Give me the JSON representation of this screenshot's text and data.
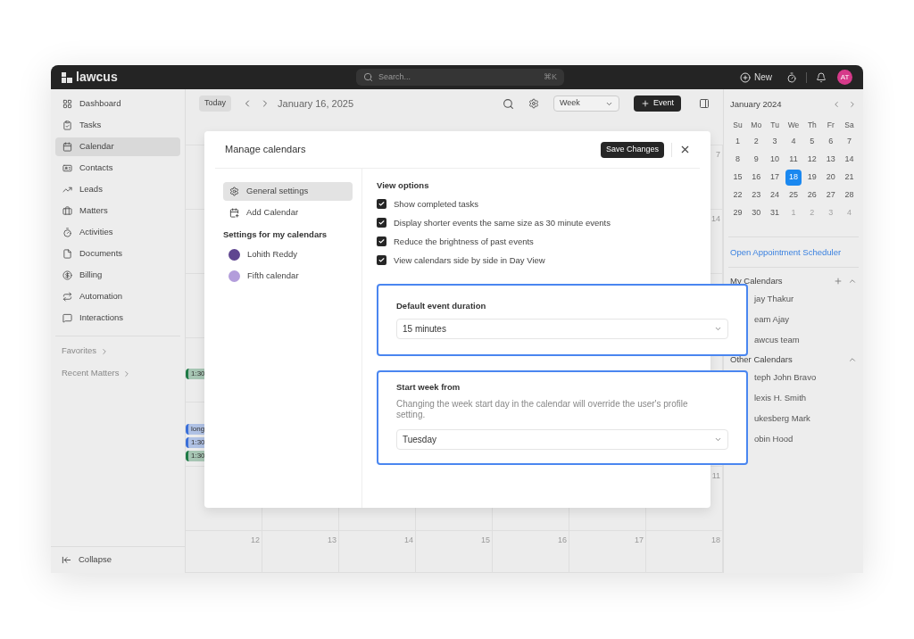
{
  "topbar": {
    "logo": "lawcus",
    "search_placeholder": "Search...",
    "shortcut": "⌘K",
    "new_button": "New",
    "avatar": "AT"
  },
  "sidebar": {
    "items": [
      {
        "kind": "dashboard",
        "label": "Dashboard",
        "selected": false
      },
      {
        "kind": "tasks",
        "label": "Tasks",
        "selected": false
      },
      {
        "kind": "calendar",
        "label": "Calendar",
        "selected": true
      },
      {
        "kind": "contacts",
        "label": "Contacts",
        "selected": false
      },
      {
        "kind": "leads",
        "label": "Leads",
        "selected": false
      },
      {
        "kind": "matters",
        "label": "Matters",
        "selected": false
      },
      {
        "kind": "activities",
        "label": "Activities",
        "selected": false
      },
      {
        "kind": "documents",
        "label": "Documents",
        "selected": false
      },
      {
        "kind": "billing",
        "label": "Billing",
        "selected": false
      },
      {
        "kind": "automation",
        "label": "Automation",
        "selected": false
      },
      {
        "kind": "interactions",
        "label": "Interactions",
        "selected": false
      }
    ],
    "sections": [
      "Favorites",
      "Recent Matters"
    ],
    "collapse": "Collapse"
  },
  "toolbar": {
    "today": "Today",
    "date": "January 16, 2025",
    "view": "Week",
    "event_button": "Event"
  },
  "grid": {
    "rows": [
      {
        "last_day": "7"
      },
      {
        "last_day": "14"
      },
      {},
      {
        "events": [
          {
            "label": "1:30",
            "color": "#1f7a46"
          }
        ]
      },
      {
        "events": [
          {
            "label": "long",
            "color": "#3a6fd8"
          },
          {
            "label": "1:30",
            "color": "#3a6fd8"
          },
          {
            "label": "1:30",
            "color": "#1f7a46"
          }
        ]
      },
      {
        "last_day": "11"
      },
      {
        "days": [
          "12",
          "13",
          "14",
          "15",
          "16",
          "17",
          "18"
        ]
      }
    ]
  },
  "right_panel": {
    "month": "January 2024",
    "weekdays": [
      "Su",
      "Mo",
      "Tu",
      "We",
      "Th",
      "Fr",
      "Sa"
    ],
    "days": [
      {
        "label": "1",
        "selected": false,
        "outside": false
      },
      {
        "label": "2",
        "selected": false,
        "outside": false
      },
      {
        "label": "3",
        "selected": false,
        "outside": false
      },
      {
        "label": "4",
        "selected": false,
        "outside": false
      },
      {
        "label": "5",
        "selected": false,
        "outside": false
      },
      {
        "label": "6",
        "selected": false,
        "outside": false
      },
      {
        "label": "7",
        "selected": false,
        "outside": false
      },
      {
        "label": "8",
        "selected": false,
        "outside": false
      },
      {
        "label": "9",
        "selected": false,
        "outside": false
      },
      {
        "label": "10",
        "selected": false,
        "outside": false
      },
      {
        "label": "11",
        "selected": false,
        "outside": false
      },
      {
        "label": "12",
        "selected": false,
        "outside": false
      },
      {
        "label": "13",
        "selected": false,
        "outside": false
      },
      {
        "label": "14",
        "selected": false,
        "outside": false
      },
      {
        "label": "15",
        "selected": false,
        "outside": false
      },
      {
        "label": "16",
        "selected": false,
        "outside": false
      },
      {
        "label": "17",
        "selected": false,
        "outside": false
      },
      {
        "label": "18",
        "selected": true,
        "outside": false
      },
      {
        "label": "19",
        "selected": false,
        "outside": false
      },
      {
        "label": "20",
        "selected": false,
        "outside": false
      },
      {
        "label": "21",
        "selected": false,
        "outside": false
      },
      {
        "label": "22",
        "selected": false,
        "outside": false
      },
      {
        "label": "23",
        "selected": false,
        "outside": false
      },
      {
        "label": "24",
        "selected": false,
        "outside": false
      },
      {
        "label": "25",
        "selected": false,
        "outside": false
      },
      {
        "label": "26",
        "selected": false,
        "outside": false
      },
      {
        "label": "27",
        "selected": false,
        "outside": false
      },
      {
        "label": "28",
        "selected": false,
        "outside": false
      },
      {
        "label": "29",
        "selected": false,
        "outside": false
      },
      {
        "label": "30",
        "selected": false,
        "outside": false
      },
      {
        "label": "31",
        "selected": false,
        "outside": false
      },
      {
        "label": "1",
        "selected": false,
        "outside": true
      },
      {
        "label": "2",
        "selected": false,
        "outside": true
      },
      {
        "label": "3",
        "selected": false,
        "outside": true
      },
      {
        "label": "4",
        "selected": false,
        "outside": true
      }
    ],
    "link": "Open Appointment Scheduler",
    "my_calendars": {
      "title": "My Calendars",
      "items": [
        "jay Thakur",
        "eam Ajay",
        "awcus team"
      ]
    },
    "other_calendars": {
      "title": "Other Calendars",
      "items": [
        "teph John Bravo",
        "lexis H. Smith",
        "ukesberg Mark",
        "obin Hood"
      ]
    }
  },
  "modal": {
    "title": "Manage calendars",
    "save_button": "Save Changes",
    "nav": [
      {
        "kind": "settings",
        "label": "General settings",
        "selected": true
      },
      {
        "kind": "add",
        "label": "Add Calendar",
        "selected": false
      }
    ],
    "calendars_heading": "Settings for my calendars",
    "calendars": [
      {
        "name": "Lohith Reddy",
        "color": "#5f4690"
      },
      {
        "name": "Fifth calendar",
        "color": "#b39ddb"
      }
    ],
    "view_options": {
      "title": "View options",
      "options": [
        {
          "label": "Show completed tasks",
          "checked": true
        },
        {
          "label": "Display shorter events the same size as 30 minute events",
          "checked": true
        },
        {
          "label": "Reduce the brightness of past events",
          "checked": true
        },
        {
          "label": "View calendars side by side in Day View",
          "checked": true
        }
      ]
    },
    "duration": {
      "title": "Default event duration",
      "value": "15 minutes"
    },
    "start_week": {
      "title": "Start week from",
      "description": "Changing the week start day in the calendar will override the user's profile setting.",
      "value": "Tuesday"
    }
  }
}
